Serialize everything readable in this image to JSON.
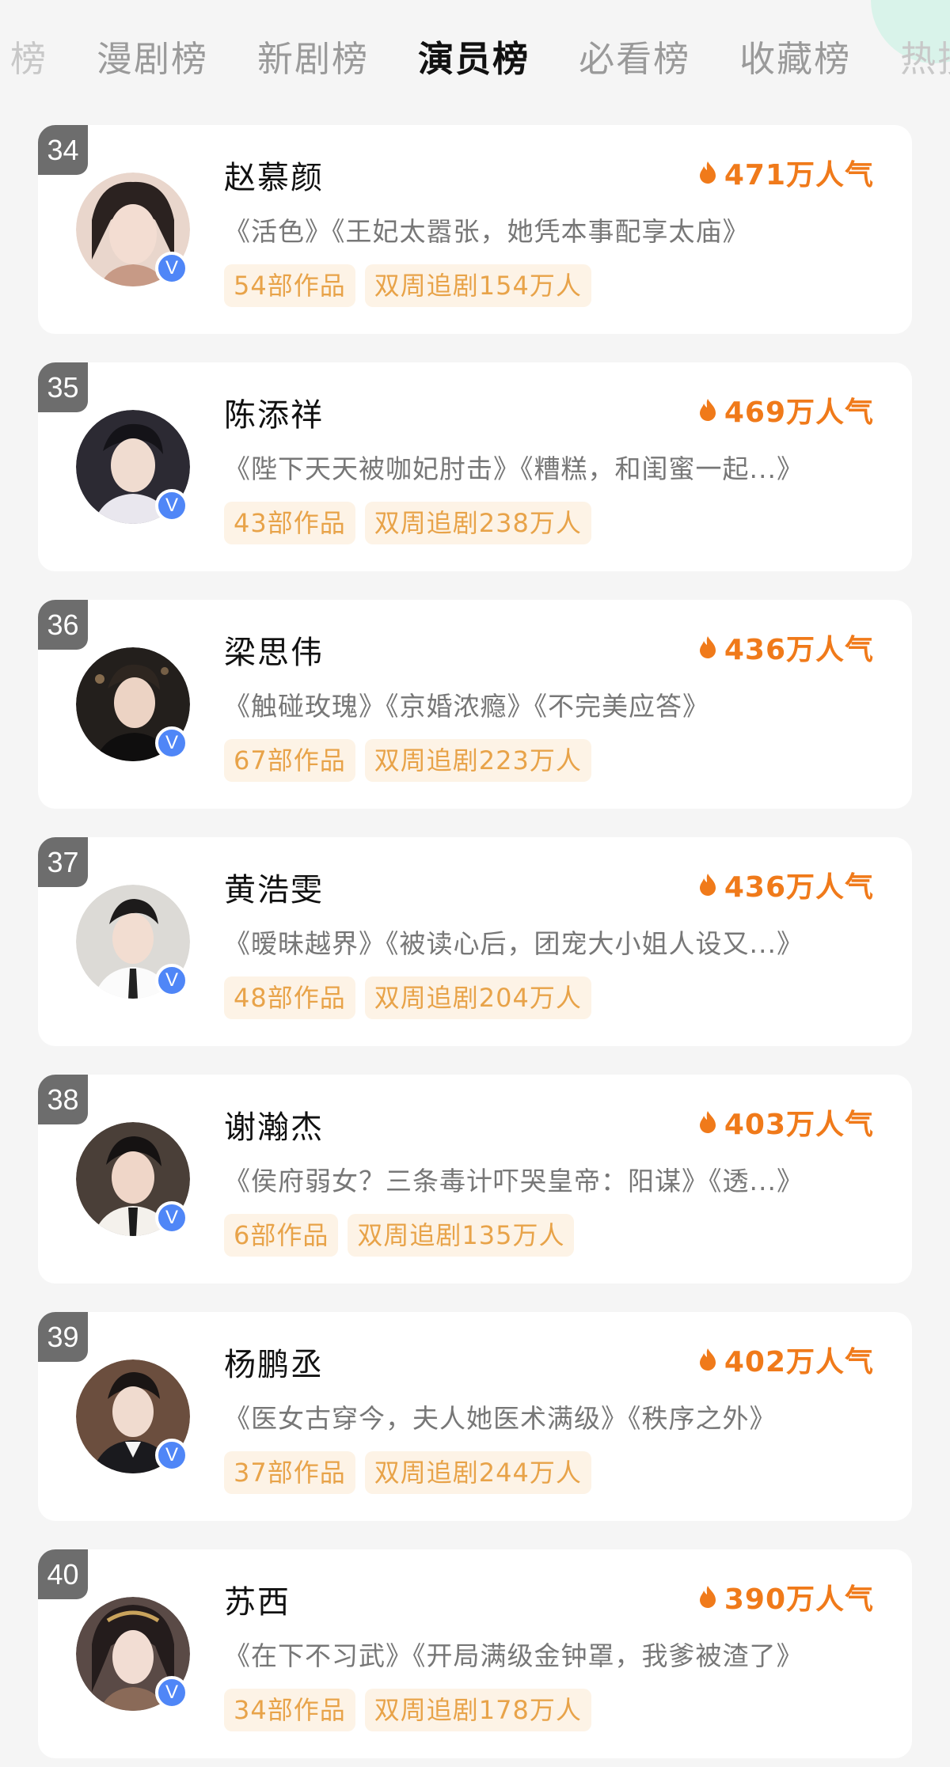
{
  "tabs": [
    {
      "label": "榜",
      "state": "edge"
    },
    {
      "label": "漫剧榜",
      "state": "normal"
    },
    {
      "label": "新剧榜",
      "state": "normal"
    },
    {
      "label": "演员榜",
      "state": "active"
    },
    {
      "label": "必看榜",
      "state": "normal"
    },
    {
      "label": "收藏榜",
      "state": "normal"
    },
    {
      "label": "热搜",
      "state": "edge"
    }
  ],
  "actors": [
    {
      "rank": "34",
      "name": "赵慕颜",
      "popularity": "471万人气",
      "works": "《活色》《王妃太嚣张，她凭本事配享太庙》",
      "tag_count": "54部作品",
      "tag_follow": "双周追剧154万人",
      "avatar_color": "#d8b8a8"
    },
    {
      "rank": "35",
      "name": "陈添祥",
      "popularity": "469万人气",
      "works": "《陛下天天被咖妃肘击》《糟糕，和闺蜜一起...》",
      "tag_count": "43部作品",
      "tag_follow": "双周追剧238万人",
      "avatar_color": "#2c2a33"
    },
    {
      "rank": "36",
      "name": "梁思伟",
      "popularity": "436万人气",
      "works": "《触碰玫瑰》《京婚浓瘾》《不完美应答》",
      "tag_count": "67部作品",
      "tag_follow": "双周追剧223万人",
      "avatar_color": "#231f1c"
    },
    {
      "rank": "37",
      "name": "黄浩雯",
      "popularity": "436万人气",
      "works": "《暧昧越界》《被读心后，团宠大小姐人设又...》",
      "tag_count": "48部作品",
      "tag_follow": "双周追剧204万人",
      "avatar_color": "#d9d6d2"
    },
    {
      "rank": "38",
      "name": "谢瀚杰",
      "popularity": "403万人气",
      "works": "《侯府弱女？三条毒计吓哭皇帝：阳谋》《透...》",
      "tag_count": "6部作品",
      "tag_follow": "双周追剧135万人",
      "avatar_color": "#4a3f38"
    },
    {
      "rank": "39",
      "name": "杨鹏丞",
      "popularity": "402万人气",
      "works": "《医女古穿今，夫人她医术满级》《秩序之外》",
      "tag_count": "37部作品",
      "tag_follow": "双周追剧244万人",
      "avatar_color": "#3b2f2a"
    },
    {
      "rank": "40",
      "name": "苏西",
      "popularity": "390万人气",
      "works": "《在下不习武》《开局满级金钟罩，我爹被渣了》",
      "tag_count": "34部作品",
      "tag_follow": "双周追剧178万人",
      "avatar_color": "#5a4a46"
    }
  ],
  "colors": {
    "accent": "#f07a1a",
    "tag_bg": "#fdf3e6",
    "tag_text": "#e8a349",
    "rank_bg": "#6d6d6d",
    "verified": "#4f86f7"
  },
  "icons": {
    "popularity": "flame-icon",
    "verified": "verified-v-icon"
  },
  "badge_text": "V"
}
